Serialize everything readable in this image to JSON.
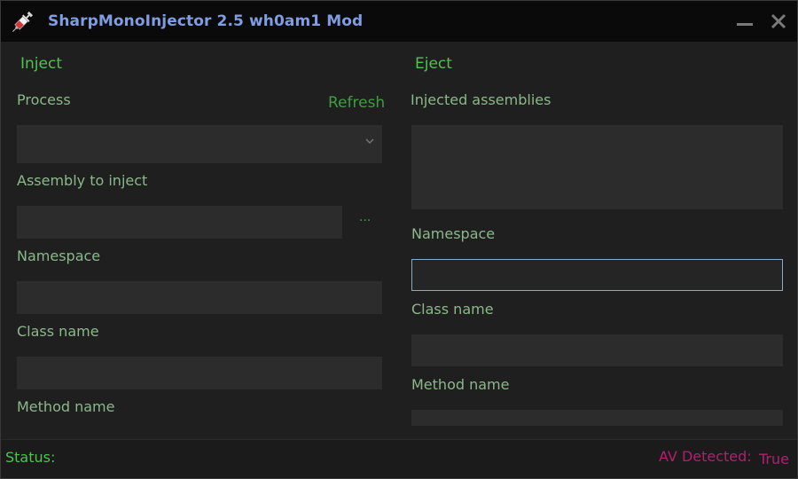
{
  "window": {
    "title": "SharpMonoInjector 2.5 wh0am1 Mod",
    "app_icon": "syringe-icon",
    "controls": {
      "minimize_icon": "minimize-icon",
      "close_icon": "close-icon"
    }
  },
  "inject": {
    "header": "Inject",
    "process_label": "Process",
    "refresh_label": "Refresh",
    "process_value": "",
    "assembly_label": "Assembly to inject",
    "assembly_value": "",
    "browse_label": "...",
    "namespace_label": "Namespace",
    "namespace_value": "",
    "class_label": "Class name",
    "class_value": "",
    "method_label": "Method name"
  },
  "eject": {
    "header": "Eject",
    "assemblies_label": "Injected assemblies",
    "assemblies": [],
    "namespace_label": "Namespace",
    "namespace_value": "",
    "class_label": "Class name",
    "class_value": "",
    "method_label": "Method name"
  },
  "status": {
    "label": "Status:",
    "value": "",
    "av_label": "AV Detected:",
    "av_value": "True"
  },
  "colors": {
    "accent_green": "#4fc24f",
    "label_green": "#8bb88b",
    "title_blue": "#7f9de0",
    "av_magenta": "#b0206f",
    "background": "#1f1f1f",
    "field": "#2c2c2c"
  }
}
